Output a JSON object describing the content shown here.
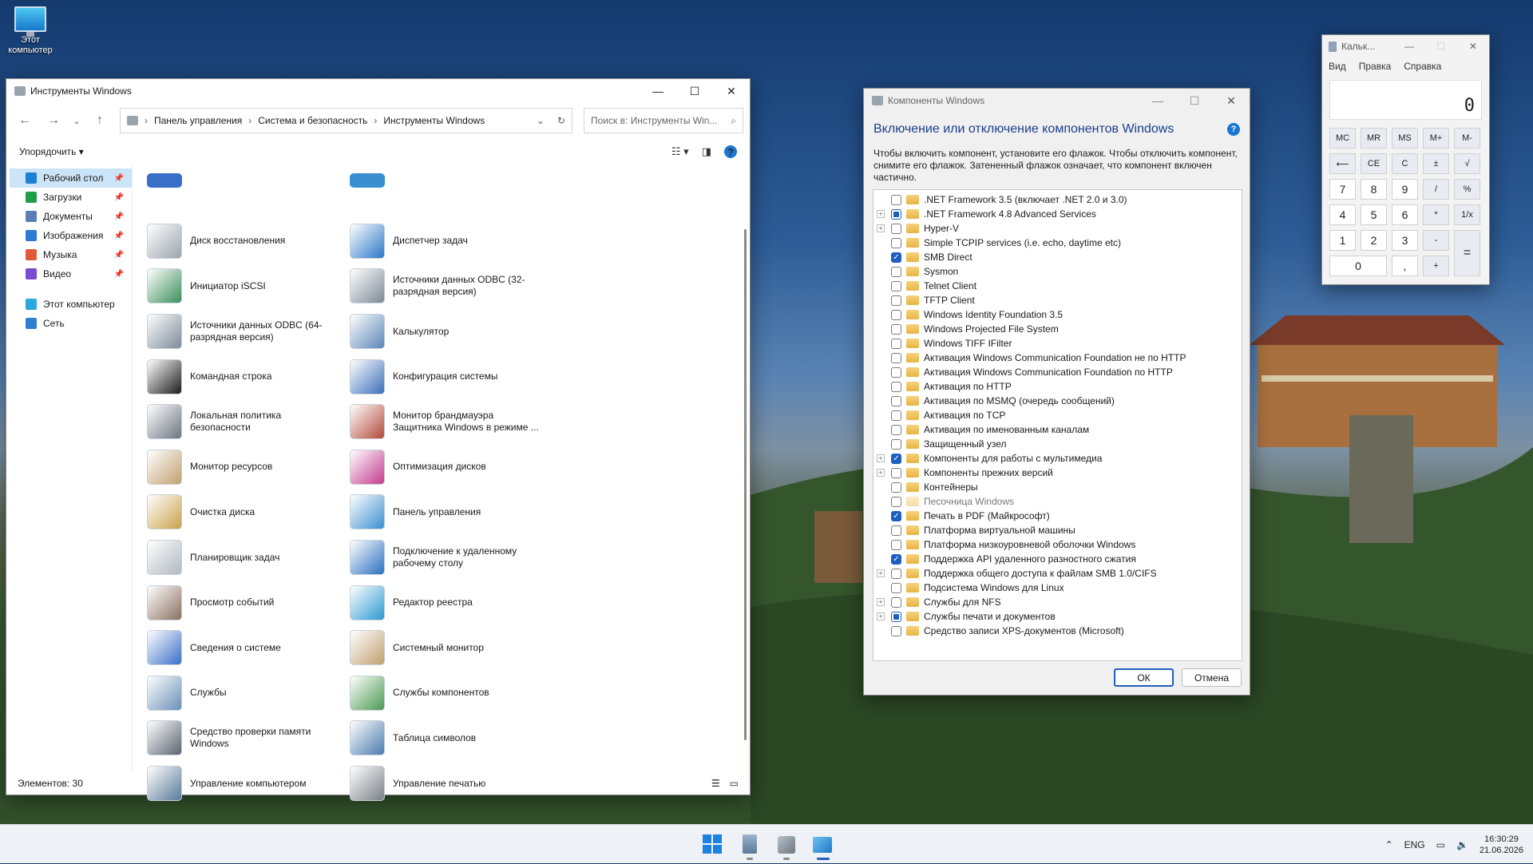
{
  "desktop": {
    "icon_label": "Этот компьютер"
  },
  "explorer": {
    "title": "Инструменты Windows",
    "breadcrumb": [
      "Панель управления",
      "Система и безопасность",
      "Инструменты Windows"
    ],
    "search_placeholder": "Поиск в: Инструменты Win...",
    "organize_label": "Упорядочить",
    "sidebar": [
      {
        "label": "Рабочий стол",
        "color": "#1e7fd6",
        "pinned": true,
        "active": true
      },
      {
        "label": "Загрузки",
        "color": "#1f9e4a",
        "pinned": true
      },
      {
        "label": "Документы",
        "color": "#5b7fb5",
        "pinned": true
      },
      {
        "label": "Изображения",
        "color": "#2b7ad6",
        "pinned": true
      },
      {
        "label": "Музыка",
        "color": "#e05a3a",
        "pinned": true
      },
      {
        "label": "Видео",
        "color": "#7a4bd0",
        "pinned": true
      },
      {
        "label": "Этот компьютер",
        "color": "#2aa8e0",
        "pinned": false
      },
      {
        "label": "Сеть",
        "color": "#2f7fd0",
        "pinned": false
      }
    ],
    "tools": [
      {
        "label": "Диск восстановления",
        "color": "#9aa4ad"
      },
      {
        "label": "Диспетчер задач",
        "color": "#2a78c8"
      },
      {
        "label": "Инициатор iSCSI",
        "color": "#3a8f5a"
      },
      {
        "label": "Источники данных ODBC (32-разрядная версия)",
        "color": "#7c8a98"
      },
      {
        "label": "Источники данных ODBC (64-разрядная версия)",
        "color": "#7c8a98"
      },
      {
        "label": "Калькулятор",
        "color": "#5a86b8"
      },
      {
        "label": "Командная строка",
        "color": "#1c1c1c"
      },
      {
        "label": "Конфигурация системы",
        "color": "#3c6fb8"
      },
      {
        "label": "Локальная политика безопасности",
        "color": "#6d7480"
      },
      {
        "label": "Монитор брандмауэра Защитника Windows в режиме ...",
        "color": "#b24a3a"
      },
      {
        "label": "Монитор ресурсов",
        "color": "#c0a070"
      },
      {
        "label": "Оптимизация дисков",
        "color": "#c23a8c"
      },
      {
        "label": "Очистка диска",
        "color": "#c9a24a"
      },
      {
        "label": "Панель управления",
        "color": "#3a8fd0"
      },
      {
        "label": "Планировщик задач",
        "color": "#b0b8c0"
      },
      {
        "label": "Подключение к удаленному рабочему столу",
        "color": "#2a6fc0"
      },
      {
        "label": "Просмотр событий",
        "color": "#8a7060"
      },
      {
        "label": "Редактор реестра",
        "color": "#2a9ad0"
      },
      {
        "label": "Сведения о системе",
        "color": "#3a6fc8"
      },
      {
        "label": "Системный монитор",
        "color": "#c0a070"
      },
      {
        "label": "Службы",
        "color": "#6a90b8"
      },
      {
        "label": "Службы компонентов",
        "color": "#4a9a50"
      },
      {
        "label": "Средство проверки памяти Windows",
        "color": "#5a6470"
      },
      {
        "label": "Таблица символов",
        "color": "#4a7ab0"
      },
      {
        "label": "Управление компьютером",
        "color": "#5a7a98"
      },
      {
        "label": "Управление печатью",
        "color": "#7a8088"
      }
    ],
    "status": "Элементов: 30"
  },
  "features": {
    "title": "Компоненты Windows",
    "heading": "Включение или отключение компонентов Windows",
    "description": "Чтобы включить компонент, установите его флажок. Чтобы отключить компонент, снимите его флажок. Затененный флажок означает, что компонент включен частично.",
    "items": [
      {
        "label": ".NET Framework 3.5 (включает .NET 2.0 и 3.0)",
        "expand": false,
        "state": "off"
      },
      {
        "label": ".NET Framework 4.8 Advanced Services",
        "expand": true,
        "state": "partial"
      },
      {
        "label": "Hyper-V",
        "expand": true,
        "state": "off"
      },
      {
        "label": "Simple TCPIP services (i.e. echo, daytime etc)",
        "expand": false,
        "state": "off"
      },
      {
        "label": "SMB Direct",
        "expand": false,
        "state": "on"
      },
      {
        "label": "Sysmon",
        "expand": false,
        "state": "off"
      },
      {
        "label": "Telnet Client",
        "expand": false,
        "state": "off"
      },
      {
        "label": "TFTP Client",
        "expand": false,
        "state": "off"
      },
      {
        "label": "Windows Identity Foundation 3.5",
        "expand": false,
        "state": "off"
      },
      {
        "label": "Windows Projected File System",
        "expand": false,
        "state": "off"
      },
      {
        "label": "Windows TIFF IFilter",
        "expand": false,
        "state": "off"
      },
      {
        "label": "Активация Windows Communication Foundation не по HTTP",
        "expand": false,
        "state": "off"
      },
      {
        "label": "Активация Windows Communication Foundation по HTTP",
        "expand": false,
        "state": "off"
      },
      {
        "label": "Активация по HTTP",
        "expand": false,
        "state": "off"
      },
      {
        "label": "Активация по MSMQ (очередь сообщений)",
        "expand": false,
        "state": "off"
      },
      {
        "label": "Активация по TCP",
        "expand": false,
        "state": "off"
      },
      {
        "label": "Активация по именованным каналам",
        "expand": false,
        "state": "off"
      },
      {
        "label": "Защищенный узел",
        "expand": false,
        "state": "off"
      },
      {
        "label": "Компоненты для работы с мультимедиа",
        "expand": true,
        "state": "on"
      },
      {
        "label": "Компоненты прежних версий",
        "expand": true,
        "state": "off"
      },
      {
        "label": "Контейнеры",
        "expand": false,
        "state": "off"
      },
      {
        "label": "Песочница Windows",
        "expand": false,
        "state": "off",
        "disabled": true
      },
      {
        "label": "Печать в PDF (Майкрософт)",
        "expand": false,
        "state": "on"
      },
      {
        "label": "Платформа виртуальной машины",
        "expand": false,
        "state": "off"
      },
      {
        "label": "Платформа низкоуровневой оболочки Windows",
        "expand": false,
        "state": "off"
      },
      {
        "label": "Поддержка API удаленного разностного сжатия",
        "expand": false,
        "state": "on"
      },
      {
        "label": "Поддержка общего доступа к файлам SMB 1.0/CIFS",
        "expand": true,
        "state": "off"
      },
      {
        "label": "Подсистема Windows для Linux",
        "expand": false,
        "state": "off"
      },
      {
        "label": "Службы для NFS",
        "expand": true,
        "state": "off"
      },
      {
        "label": "Службы печати и документов",
        "expand": true,
        "state": "partial"
      },
      {
        "label": "Средство записи XPS-документов (Microsoft)",
        "expand": false,
        "state": "off"
      }
    ],
    "ok_label": "ОК",
    "cancel_label": "Отмена"
  },
  "calculator": {
    "title": "Кальк...",
    "menu": [
      "Вид",
      "Правка",
      "Справка"
    ],
    "display": "0",
    "keys": [
      {
        "label": "MC",
        "kind": "op"
      },
      {
        "label": "MR",
        "kind": "op"
      },
      {
        "label": "MS",
        "kind": "op"
      },
      {
        "label": "M+",
        "kind": "op"
      },
      {
        "label": "M-",
        "kind": "op"
      },
      {
        "label": "⟵",
        "kind": "op"
      },
      {
        "label": "CE",
        "kind": "op"
      },
      {
        "label": "C",
        "kind": "op"
      },
      {
        "label": "±",
        "kind": "op"
      },
      {
        "label": "√",
        "kind": "op"
      },
      {
        "label": "7",
        "kind": "num"
      },
      {
        "label": "8",
        "kind": "num"
      },
      {
        "label": "9",
        "kind": "num"
      },
      {
        "label": "/",
        "kind": "op"
      },
      {
        "label": "%",
        "kind": "op"
      },
      {
        "label": "4",
        "kind": "num"
      },
      {
        "label": "5",
        "kind": "num"
      },
      {
        "label": "6",
        "kind": "num"
      },
      {
        "label": "*",
        "kind": "op"
      },
      {
        "label": "1/x",
        "kind": "op"
      },
      {
        "label": "1",
        "kind": "num"
      },
      {
        "label": "2",
        "kind": "num"
      },
      {
        "label": "3",
        "kind": "num"
      },
      {
        "label": "-",
        "kind": "op"
      },
      {
        "label": "=",
        "kind": "op tall"
      },
      {
        "label": "0",
        "kind": "num wide"
      },
      {
        "label": ",",
        "kind": "num"
      },
      {
        "label": "+",
        "kind": "op"
      }
    ]
  },
  "taskbar": {
    "language": "ENG",
    "time": "16:30:29",
    "date": "21.06.2026"
  }
}
